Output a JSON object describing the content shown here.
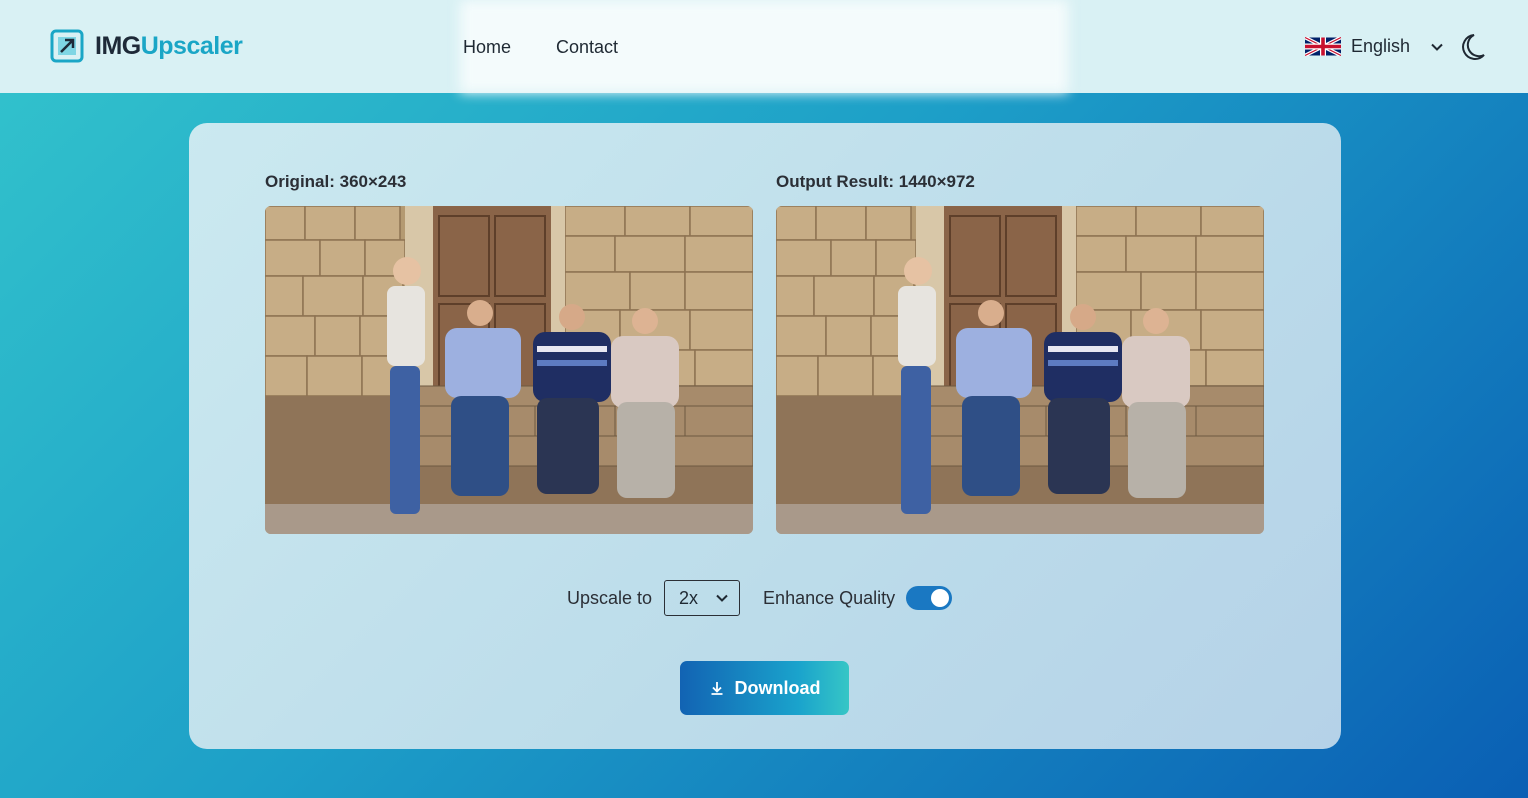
{
  "header": {
    "logo": {
      "part1": "IMG",
      "part2": "Upscaler"
    },
    "nav": [
      {
        "label": "Home"
      },
      {
        "label": "Contact"
      }
    ],
    "language": {
      "label": "English",
      "flag": "uk-flag-icon"
    },
    "theme_icon": "moon-icon"
  },
  "main": {
    "original_label": "Original: 360×243",
    "output_label": "Output Result: 1440×972",
    "upscale_label": "Upscale to",
    "upscale_value": "2x",
    "enhance_label": "Enhance Quality",
    "enhance_enabled": true,
    "download_label": "Download"
  },
  "colors": {
    "brand_dark": "#1e2a38",
    "brand_accent": "#1aa6c6",
    "toggle_on": "#1a78c2"
  }
}
